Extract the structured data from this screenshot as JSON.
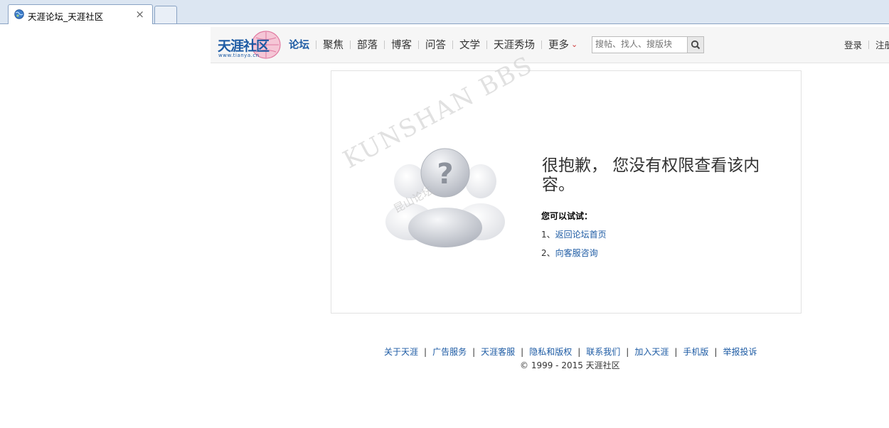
{
  "browser": {
    "tab_title": "天涯论坛_天涯社区",
    "close_glyph": "×"
  },
  "header": {
    "logo_text": "天涯社区",
    "logo_sub": "www.tianya.cn",
    "nav": [
      {
        "label": "论坛",
        "active": true
      },
      {
        "label": "聚焦"
      },
      {
        "label": "部落"
      },
      {
        "label": "博客"
      },
      {
        "label": "问答"
      },
      {
        "label": "文学"
      },
      {
        "label": "天涯秀场"
      },
      {
        "label": "更多"
      }
    ],
    "more_arrow": "⌄",
    "search_placeholder": "搜帖、找人、搜版块",
    "login": "登录",
    "register": "注册"
  },
  "error": {
    "message": "很抱歉，  您没有权限查看该内容。",
    "try_label": "您可以试试：",
    "options": [
      {
        "num": "1、",
        "label": "返回论坛首页"
      },
      {
        "num": "2、",
        "label": "向客服咨询"
      }
    ],
    "watermark": "KUNSHAN BBS",
    "watermark_cn": "昆山论坛"
  },
  "footer": {
    "links": [
      "关于天涯",
      "广告服务",
      "天涯客服",
      "隐私和版权",
      "联系我们",
      "加入天涯",
      "手机版",
      "举报投诉"
    ],
    "copyright": "© 1999 - 2015 天涯社区"
  },
  "colors": {
    "link": "#1d5ba4",
    "tabbar": "#dce6f2"
  }
}
